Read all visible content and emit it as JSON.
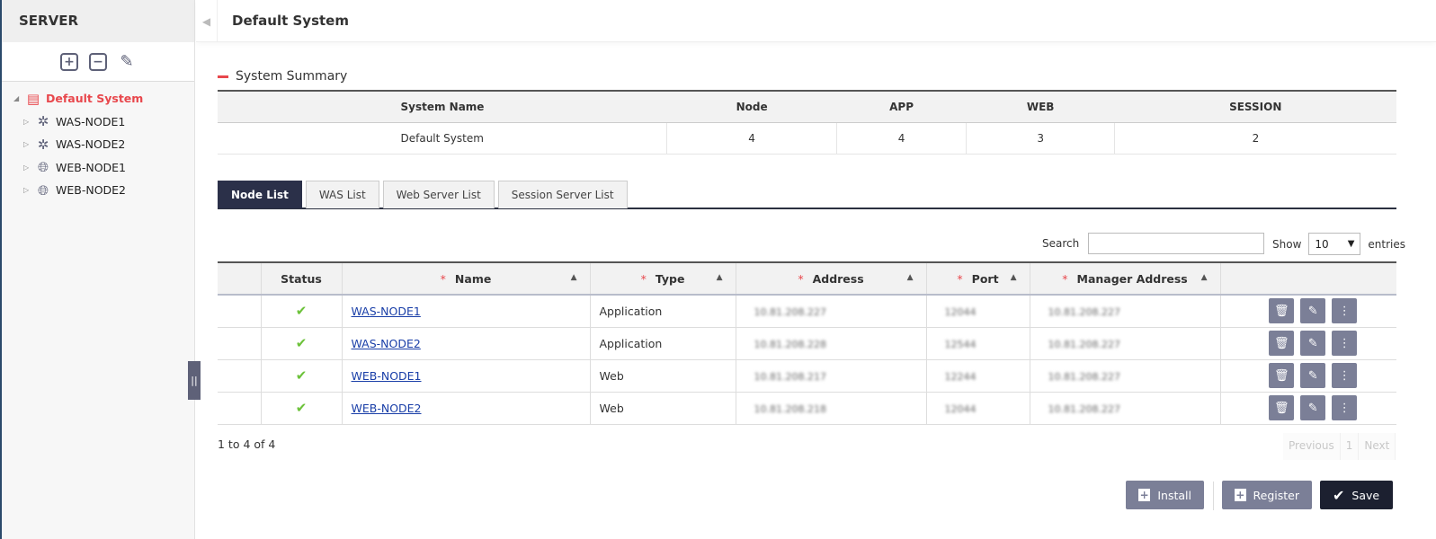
{
  "sidebar": {
    "title": "SERVER",
    "tools": [
      {
        "icon": "plus-square-icon"
      },
      {
        "icon": "minus-square-icon"
      },
      {
        "icon": "edit-icon"
      }
    ],
    "tree": {
      "root": {
        "label": "Default System",
        "icon": "system-icon",
        "color": "#e8474c"
      },
      "children": [
        {
          "label": "WAS-NODE1",
          "icon": "was-node-icon"
        },
        {
          "label": "WAS-NODE2",
          "icon": "was-node-icon"
        },
        {
          "label": "WEB-NODE1",
          "icon": "globe-icon"
        },
        {
          "label": "WEB-NODE2",
          "icon": "globe-icon"
        }
      ]
    }
  },
  "header": {
    "title": "Default System"
  },
  "summary": {
    "title": "System Summary",
    "columns": [
      "System Name",
      "Node",
      "APP",
      "WEB",
      "SESSION"
    ],
    "row": [
      "Default System",
      "4",
      "4",
      "3",
      "2"
    ]
  },
  "tabs": [
    {
      "label": "Node List",
      "active": true
    },
    {
      "label": "WAS List"
    },
    {
      "label": "Web Server List"
    },
    {
      "label": "Session Server List"
    }
  ],
  "search": {
    "label": "Search",
    "value": ""
  },
  "page_size": {
    "show_label": "Show",
    "value": "10",
    "entries_label": "entries"
  },
  "nodes": {
    "columns": [
      "",
      "Status",
      "Name",
      "Type",
      "Address",
      "Port",
      "Manager Address",
      ""
    ],
    "required_marker": "*",
    "rows": [
      {
        "status": "✔",
        "name": "WAS-NODE1",
        "type": "Application",
        "address": "10.81.208.227",
        "port": "12044",
        "manager": "10.81.208.227"
      },
      {
        "status": "✔",
        "name": "WAS-NODE2",
        "type": "Application",
        "address": "10.81.208.228",
        "port": "12544",
        "manager": "10.81.208.227"
      },
      {
        "status": "✔",
        "name": "WEB-NODE1",
        "type": "Web",
        "address": "10.81.208.217",
        "port": "12244",
        "manager": "10.81.208.227"
      },
      {
        "status": "✔",
        "name": "WEB-NODE2",
        "type": "Web",
        "address": "10.81.208.218",
        "port": "12044",
        "manager": "10.81.208.227"
      }
    ]
  },
  "footer": {
    "info": "1 to 4 of 4",
    "pager": {
      "previous": "Previous",
      "page": "1",
      "next": "Next"
    }
  },
  "buttons": {
    "install": "Install",
    "register": "Register",
    "save": "Save"
  }
}
